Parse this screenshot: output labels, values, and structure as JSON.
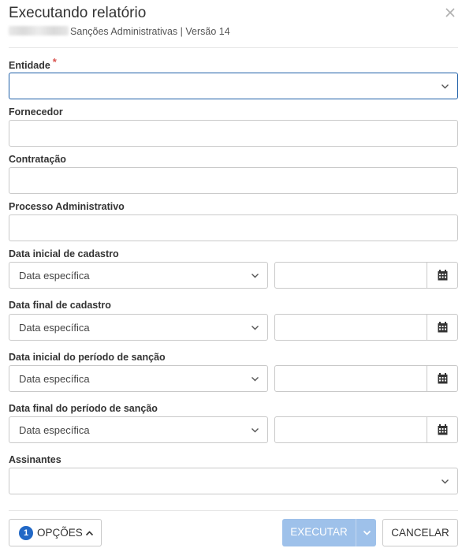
{
  "dialog": {
    "title": "Executando relatório",
    "subtitle": "Sanções Administrativas | Versão 14"
  },
  "fields": {
    "entidade": {
      "label": "Entidade",
      "required_mark": "*",
      "value": ""
    },
    "fornecedor": {
      "label": "Fornecedor",
      "value": ""
    },
    "contratacao": {
      "label": "Contratação",
      "value": ""
    },
    "processo": {
      "label": "Processo Administrativo",
      "value": ""
    },
    "data_inicial_cadastro": {
      "label": "Data inicial de cadastro",
      "option": "Data específica",
      "date": ""
    },
    "data_final_cadastro": {
      "label": "Data final de cadastro",
      "option": "Data específica",
      "date": ""
    },
    "data_inicial_sancao": {
      "label": "Data inicial do período de sanção",
      "option": "Data específica",
      "date": ""
    },
    "data_final_sancao": {
      "label": "Data final do período de sanção",
      "option": "Data específica",
      "date": ""
    },
    "assinantes": {
      "label": "Assinantes",
      "value": ""
    }
  },
  "footer": {
    "options_count": "1",
    "options_label": "OPÇÕES",
    "execute_label": "EXECUTAR",
    "cancel_label": "CANCELAR"
  },
  "icons": {
    "close": "close-icon",
    "chevron": "chevron-down-icon",
    "calendar": "calendar-icon",
    "chevron_up": "chevron-up-icon"
  },
  "colors": {
    "focus_border": "#1e5fa8",
    "badge": "#2168c6",
    "execute_disabled": "#9ec1ea",
    "required": "#d9534f"
  }
}
